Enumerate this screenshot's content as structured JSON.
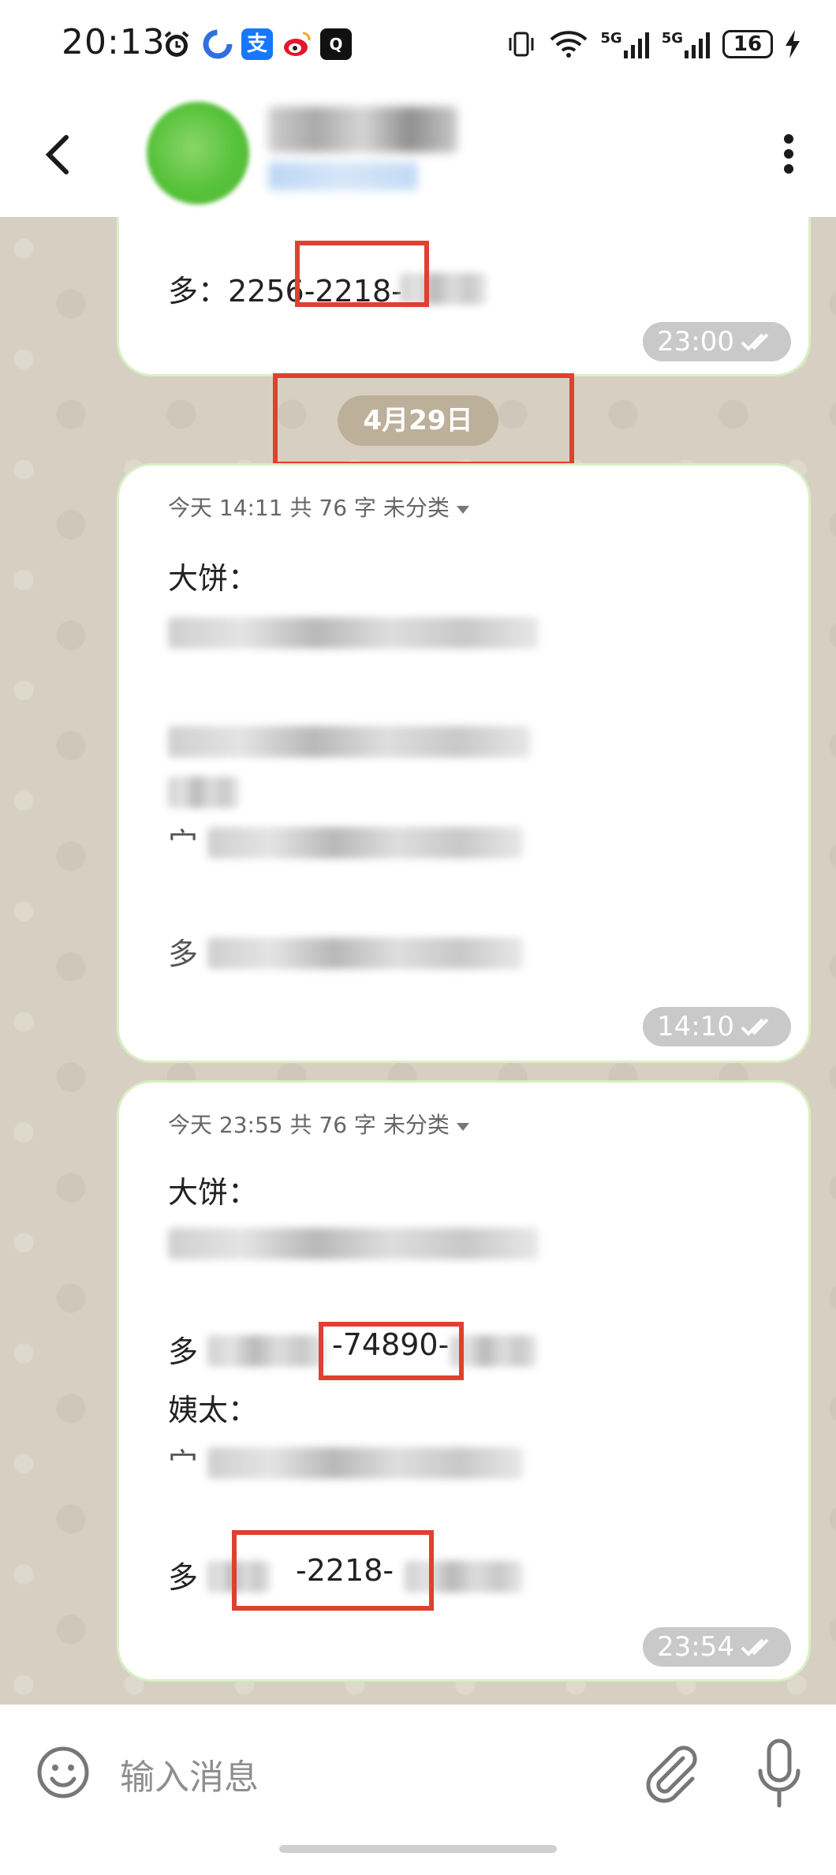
{
  "status_bar": {
    "time": "20:13",
    "app_icons": [
      "alarm-icon",
      "browser-icon",
      "alipay-icon",
      "weibo-icon",
      "app-icon"
    ],
    "alipay_char": "支",
    "battery": "16",
    "network_1": "5G",
    "network_2": "5G"
  },
  "header": {
    "back_icon": "chevron-left-icon",
    "more_icon": "vertical-dots-icon"
  },
  "messages": {
    "top_bubble": {
      "line_prefix": "多：2256",
      "line_highlight": "-2218-",
      "time": "23:00"
    },
    "date_separator": "4月29日",
    "note1": {
      "meta": "今天 14:11  共 76 字   未分类",
      "heading": "大饼：",
      "line3_label": "宀",
      "line4_label": "多",
      "time": "14:10"
    },
    "note2": {
      "meta": "今天 23:55  共 76 字   未分类",
      "heading": "大饼：",
      "line2_label": "多",
      "line2_highlight": "-74890-",
      "heading2": "姨太：",
      "line3_label": "宀",
      "line4_label": "多",
      "line4_highlight": "-2218-",
      "time": "23:54"
    }
  },
  "input": {
    "placeholder": "输入消息",
    "emoji_icon": "emoji-icon",
    "attach_icon": "paperclip-icon",
    "mic_icon": "microphone-icon"
  },
  "colors": {
    "chat_bg": "#d7d0c2",
    "bubble_border": "#d8f0c4",
    "highlight_box": "#e0402f",
    "date_chip": "#bdb09a"
  }
}
